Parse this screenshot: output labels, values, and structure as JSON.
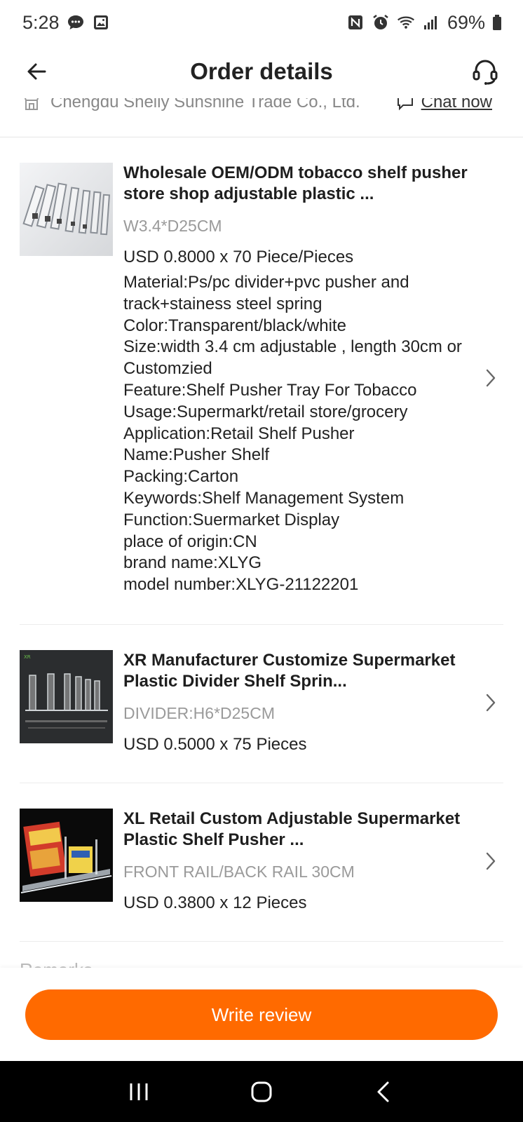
{
  "status_bar": {
    "time": "5:28",
    "battery": "69%",
    "icons": [
      "chat-bubble-icon",
      "image-icon",
      "nfc-icon",
      "alarm-icon",
      "wifi-icon",
      "signal-icon",
      "battery-icon"
    ]
  },
  "header": {
    "title": "Order details",
    "back_icon": "arrow-left-icon",
    "support_icon": "headset-icon"
  },
  "supplier": {
    "name": "Chengdu Shelly Sunshine Trade Co., Ltd.",
    "chat_label": "Chat now"
  },
  "items": [
    {
      "title": "Wholesale OEM/ODM tobacco shelf pusher store shop adjustable plastic ...",
      "sku": "W3.4*D25CM",
      "price": "USD 0.8000 x 70 Piece/Pieces",
      "specs": [
        "Material:Ps/pc divider+pvc pusher and track+stainess steel spring",
        "Color:Transparent/black/white",
        "Size:width 3.4 cm adjustable , length 30cm or Customzied",
        "Feature:Shelf Pusher Tray For Tobacco",
        "Usage:Supermarkt/retail store/grocery",
        "Application:Retail Shelf Pusher",
        "Name:Pusher Shelf",
        "Packing:Carton",
        "Keywords:Shelf Management System",
        "Function:Suermarket Display",
        "place of origin:CN",
        "brand name:XLYG",
        "model number:XLYG-21122201"
      ]
    },
    {
      "title": "XR Manufacturer Customize Supermarket Plastic Divider Shelf Sprin...",
      "sku": "DIVIDER:H6*D25CM",
      "price": "USD 0.5000 x 75 Pieces",
      "specs": []
    },
    {
      "title": "XL Retail Custom Adjustable Supermarket Plastic Shelf Pusher ...",
      "sku": "FRONT RAIL/BACK RAIL 30CM",
      "price": "USD 0.3800 x 12 Pieces",
      "specs": []
    }
  ],
  "next_section_title": "Remarks",
  "footer": {
    "write_review_label": "Write review",
    "accent_color": "#ff6a00"
  },
  "system_nav": {
    "icons": [
      "recent-apps-icon",
      "home-icon",
      "back-icon"
    ]
  }
}
